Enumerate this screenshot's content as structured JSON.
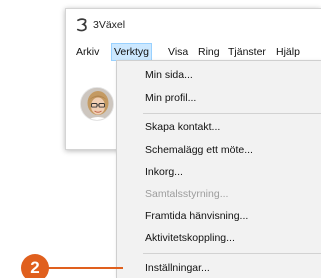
{
  "window": {
    "title": "3Växel",
    "logo_icon": "three-logo-icon"
  },
  "menubar": {
    "items": [
      {
        "label": "Arkiv"
      },
      {
        "label": "Verktyg",
        "active": true
      },
      {
        "label": "Visa"
      },
      {
        "label": "Ring"
      },
      {
        "label": "Tjänster"
      },
      {
        "label": "Hjälp"
      }
    ]
  },
  "tools_menu": {
    "items": [
      {
        "label": "Min sida..."
      },
      {
        "label": "Min profil..."
      },
      {
        "label": "Skapa kontakt..."
      },
      {
        "label": "Schemalägg ett möte..."
      },
      {
        "label": "Inkorg..."
      },
      {
        "label": "Samtalsstyrning...",
        "disabled": true
      },
      {
        "label": "Framtida hänvisning..."
      },
      {
        "label": "Aktivitetskoppling..."
      },
      {
        "label": "Inställningar..."
      }
    ]
  },
  "callout": {
    "number": "2",
    "color": "#e0601e"
  },
  "colors": {
    "menu_highlight": "#cce8ff",
    "menu_highlight_border": "#99d1ff",
    "dropdown_background": "#f2f2f2"
  }
}
